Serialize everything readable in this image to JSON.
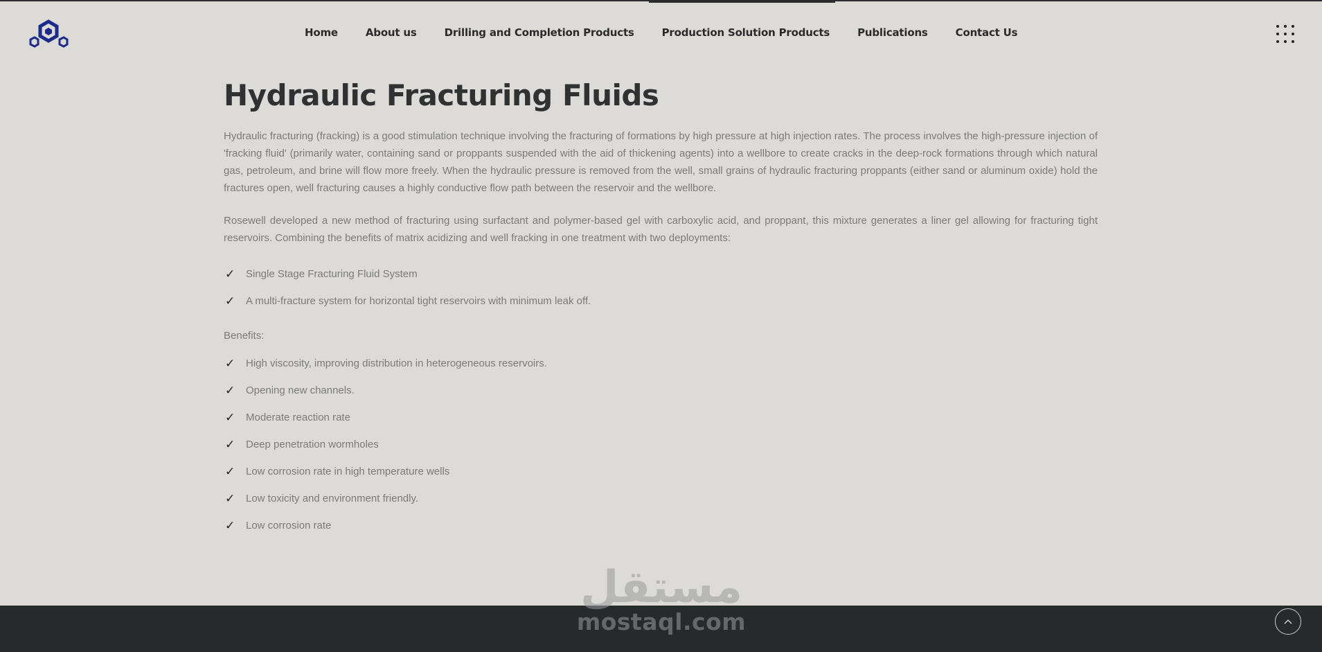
{
  "nav": {
    "items": [
      {
        "label": "Home"
      },
      {
        "label": "About us"
      },
      {
        "label": "Drilling and Completion Products"
      },
      {
        "label": "Production Solution Products"
      },
      {
        "label": "Publications"
      },
      {
        "label": "Contact Us"
      }
    ]
  },
  "icons": {
    "logo": "hexagon-logo",
    "menu": "grid-dots-icon",
    "check": "checkmark-icon",
    "scroll_top": "chevron-up-icon"
  },
  "colors": {
    "logo_blue": "#1c2a8c",
    "background": "#dcdbd8",
    "footer": "#272a2b"
  },
  "article": {
    "title": "Hydraulic Fracturing Fluids",
    "paragraphs": [
      "Hydraulic fracturing (fracking) is a good stimulation technique involving the fracturing of formations by high pressure at high injection rates. The process involves the high-pressure injection of 'fracking fluid' (primarily water, containing sand or proppants suspended with the aid of thickening agents) into a wellbore to create cracks in the deep-rock formations through which natural gas, petroleum, and brine will flow more freely. When the hydraulic pressure is removed from the well, small grains of hydraulic fracturing proppants (either sand or aluminum oxide) hold the fractures open, well fracturing causes a highly conductive flow path between the reservoir and the wellbore.",
      "Rosewell developed a new method of fracturing using surfactant and polymer-based gel with carboxylic acid, and proppant, this mixture generates a liner gel allowing for fracturing tight reservoirs. Combining the benefits of matrix acidizing and well fracking in one treatment with two deployments:"
    ],
    "deployments": [
      "Single Stage Fracturing Fluid System",
      "A multi-fracture system for horizontal tight reservoirs with minimum leak off."
    ],
    "benefits_label": "Benefits:",
    "benefits": [
      "High viscosity, improving distribution in heterogeneous reservoirs.",
      "Opening new channels.",
      "Moderate reaction rate",
      "Deep penetration wormholes",
      "Low corrosion rate in high temperature wells",
      "Low toxicity and environment friendly.",
      "Low corrosion rate"
    ]
  },
  "watermark": {
    "arabic": "مستقل",
    "latin": "mostaql.com"
  }
}
